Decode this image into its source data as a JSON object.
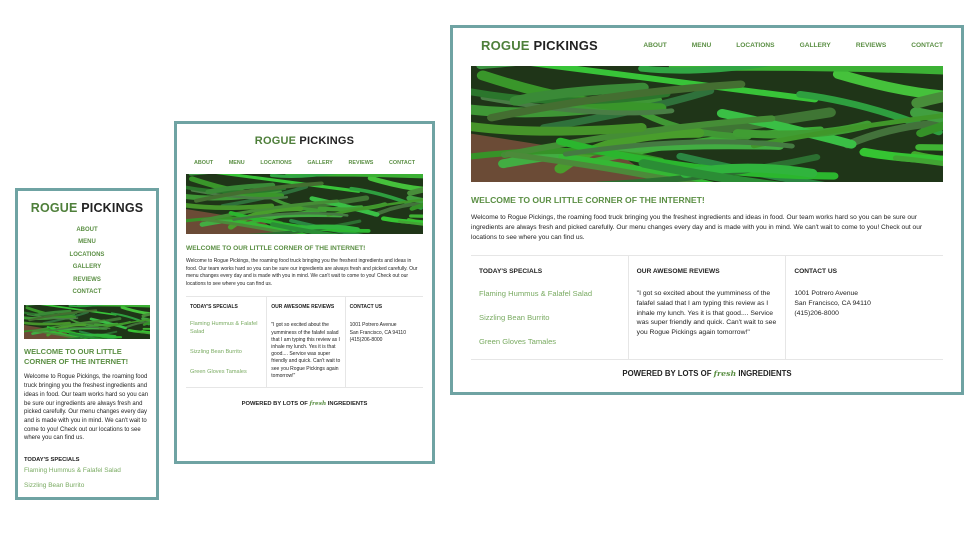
{
  "site": {
    "logo_part1": "ROGUE",
    "logo_part2": "PICKINGS",
    "nav": [
      "ABOUT",
      "MENU",
      "LOCATIONS",
      "GALLERY",
      "REVIEWS",
      "CONTACT"
    ],
    "welcome_heading": "WELCOME TO OUR LITTLE CORNER OF THE INTERNET!",
    "welcome_text": "Welcome to Rogue Pickings, the roaming food truck bringing you the freshest ingredients and ideas in food. Our team works hard so you can be sure our ingredients are always fresh and picked carefully. Our menu changes every day and is made with you in mind. We can't wait to come to you! Check out our locations to see where you can find us.",
    "specials_heading": "TODAY'S SPECIALS",
    "specials": [
      "Flaming Hummus & Falafel Salad",
      "Sizzling Bean Burrito",
      "Green Gloves Tamales"
    ],
    "reviews_heading": "OUR AWESOME REVIEWS",
    "review_text": "\"I got so excited about the yumminess of the falafel salad that I am typing this review as I inhale my lunch. Yes it is that good.... Service was super friendly and quick. Can't wait to see you Rogue Pickings again tomorrow!\"",
    "contact_heading": "CONTACT US",
    "contact_address1": "1001 Potrero Avenue",
    "contact_address2": "San Francisco, CA 94110",
    "contact_phone": "(415)206-8000",
    "footer_before": "POWERED BY LOTS OF",
    "footer_fresh": "fresh",
    "footer_after": "INGREDIENTS"
  },
  "colors": {
    "frame_border": "#6fa3a3",
    "accent_green": "#5b8f44",
    "special_green": "#7aab62"
  }
}
